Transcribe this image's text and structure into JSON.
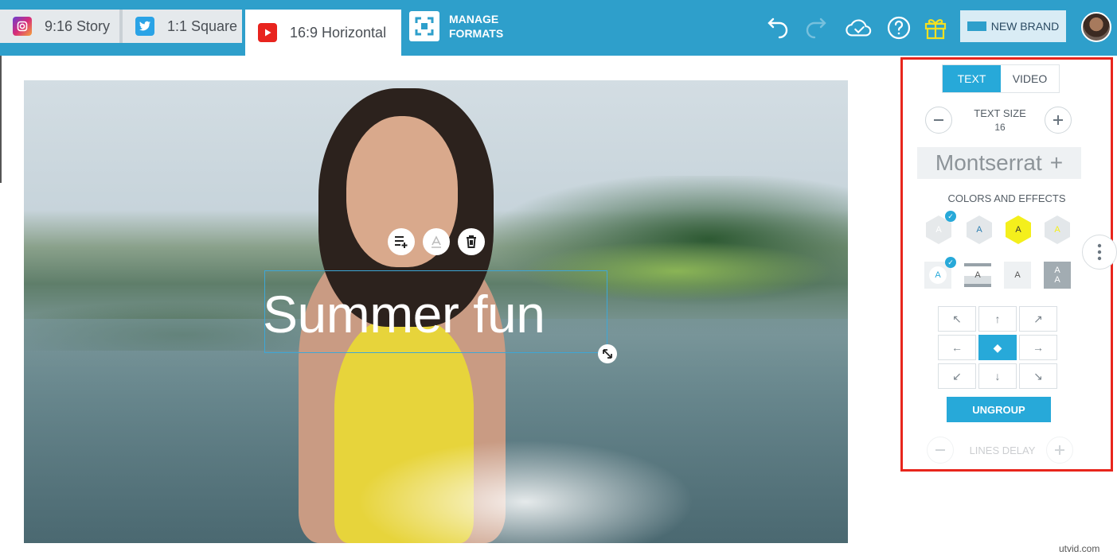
{
  "tabs": [
    {
      "label": "9:16 Story",
      "icon": "instagram-icon"
    },
    {
      "label": "1:1 Square",
      "icon": "twitter-icon"
    },
    {
      "label": "16:9 Horizontal",
      "icon": "youtube-icon",
      "active": true
    }
  ],
  "manage_formats": {
    "line1": "MANAGE",
    "line2": "FORMATS"
  },
  "header_buttons": {
    "new_brand": "NEW BRAND"
  },
  "canvas": {
    "caption": "Summer fun"
  },
  "panel": {
    "tabs": {
      "text": "TEXT",
      "video": "VIDEO"
    },
    "text_size_label": "TEXT SIZE",
    "text_size_value": "16",
    "font_name": "Montserrat",
    "colors_effects_label": "COLORS AND EFFECTS",
    "effect_glyph": "A",
    "ungroup": "UNGROUP",
    "lines_delay": "LINES DELAY",
    "accent": "#27a9d9"
  },
  "watermark": "utvid.com"
}
